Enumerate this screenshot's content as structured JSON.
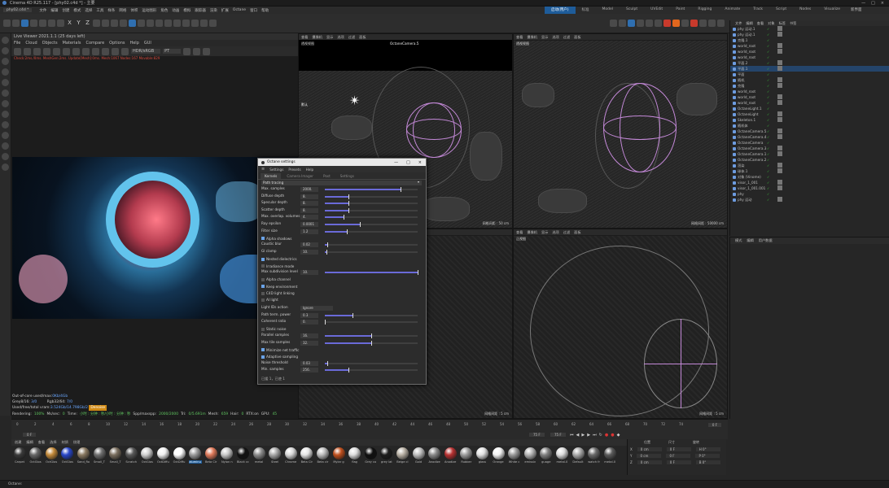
{
  "window": {
    "title": "Cinema 4D R25.117 - [phy02.c4d *] - 主要",
    "buttons": [
      "—",
      "□",
      "×"
    ]
  },
  "tabs": {
    "file": "phy02.c4d *"
  },
  "menubar": {
    "items": [
      "文件",
      "编辑",
      "创建",
      "模式",
      "选择",
      "工具",
      "样条",
      "网格",
      "体积",
      "运动图形",
      "角色",
      "动画",
      "模拟",
      "跟踪器",
      "渲染",
      "扩展",
      "Octane",
      "窗口",
      "帮助"
    ],
    "layouts": [
      "启动",
      "标准",
      "Model",
      "Sculpt",
      "UVEdit",
      "Paint",
      "Rigging",
      "Animate",
      "Track",
      "Script",
      "Nodes",
      "Visualize"
    ],
    "active_layout": "启动(用户)",
    "search": "新界面"
  },
  "toolbar": {
    "axes": [
      "X",
      "Y",
      "Z"
    ]
  },
  "live_viewer": {
    "title": "Live Viewer 2021.1.1 (25 days left)",
    "menu": [
      "File",
      "Cloud",
      "Objects",
      "Materials",
      "Compare",
      "Options",
      "Help",
      "GUI"
    ],
    "mode": "HDR/sRGB",
    "kernel": "PT",
    "info": "Check:2ms./0ms. MeshGen:2ms. Update[Mesh]:0ms. Mesh:1067 Nodes:167 Movable:829"
  },
  "render_stats": {
    "line1_label": "Out-of-core used/max:",
    "line1_val": "0Kb/4Gb",
    "line2_label": "Grey8/16:",
    "line2_val": "3/0",
    "line2b_label": "Rgb32/64:",
    "line2b_val": "7/0",
    "line3_label": "Used/free/total vram:",
    "line3_val": "3.524Gb/14.798Gb/2",
    "line3_badge": "Denoise"
  },
  "status": {
    "rendering_label": "Rendering:",
    "rendering": "100%",
    "ms_label": "Ms/sec:",
    "ms": "0",
    "time_label": "Time:",
    "time": "小时 : 分钟 : 秒/小时 : 分钟 : 秒",
    "spp_label": "Spp/maxspp:",
    "spp": "2000/2000",
    "tri_label": "Tri:",
    "tri": "0/5.691m",
    "mesh_label": "Mesh:",
    "mesh": "659",
    "hair_label": "Hair:",
    "hair": "0",
    "rtx_label": "RTX:on",
    "gpu_label": "GPU:",
    "gpu": "45"
  },
  "viewports": {
    "menu": [
      "查看",
      "摄像机",
      "显示",
      "选项",
      "过滤",
      "面板"
    ],
    "tl_title": "透视视图",
    "tl_camera": "OctaneCamera.5",
    "tl_label": "默认",
    "tl_scale": "网格间距 : 50 cm",
    "tr_title": "透视视图",
    "tr_scale": "网格间距 : 50000 cm",
    "br_title": "正视图",
    "br_scale": "网格间距 : 5 cm",
    "bl_scale": "网格间距 : 5 cm"
  },
  "object_manager": {
    "menu": [
      "文件",
      "编辑",
      "查看",
      "对象",
      "标签",
      "书签"
    ],
    "items": [
      "phy 运动.1",
      "phy 运动.1",
      "克隆.1",
      "world_root",
      "world_root",
      "world_root",
      "平面.2",
      "平面.1",
      "平面",
      "随机",
      "克隆",
      "world_root",
      "world_root",
      "world_root",
      "OctaneLight.1",
      "OctaneLight",
      "Skeleton.1",
      "随机体",
      "OctaneCamera.5",
      "OctaneCamera.4",
      "OctaneCamera",
      "OctaneCamera.3",
      "OctaneCamera.1",
      "OctaneCamera.2",
      "渲染",
      "球体.1",
      "对象 (Vinome)",
      "visor_1_001",
      "visor_1_001.001",
      "phy",
      "phy 运动"
    ]
  },
  "attributes": {
    "menu": [
      "模式",
      "编辑",
      "用户数据"
    ]
  },
  "octane_settings": {
    "title": "Octane settings",
    "menu": [
      "Settings",
      "Presets",
      "Help"
    ],
    "tabs": [
      "Kernels",
      "Camera Imager",
      "Post",
      "Settings"
    ],
    "kernel": "Path tracing",
    "params": [
      {
        "label": "Max. samples",
        "value": "2000.",
        "fill": 0.82
      },
      {
        "label": "Diffuse depth",
        "value": "8.",
        "fill": 0.25
      },
      {
        "label": "Specular depth",
        "value": "8.",
        "fill": 0.25
      },
      {
        "label": "Scatter depth",
        "value": "8.",
        "fill": 0.25
      },
      {
        "label": "Max. overlap. volumes",
        "value": "4.",
        "fill": 0.2
      },
      {
        "label": "Ray epsilon",
        "value": "0.0001",
        "fill": 0.38
      },
      {
        "label": "Filter size",
        "value": "1.2",
        "fill": 0.24
      }
    ],
    "checks1": [
      {
        "label": "Alpha shadows",
        "on": true
      }
    ],
    "params2": [
      {
        "label": "Caustic blur",
        "value": "0.02",
        "fill": 0.03
      },
      {
        "label": "GI clamp",
        "value": "10.",
        "fill": 0.02
      }
    ],
    "checks2": [
      {
        "label": "Nested dielectrics",
        "on": true
      },
      {
        "label": "Irradiance mode",
        "on": false
      }
    ],
    "params3": [
      {
        "label": "Max subdivision level",
        "value": "10.",
        "fill": 1.0
      }
    ],
    "checks3": [
      {
        "label": "Alpha channel",
        "on": false
      },
      {
        "label": "Keep environment",
        "on": true
      },
      {
        "label": "C4D light linking",
        "on": false
      },
      {
        "label": "AI light",
        "on": false
      }
    ],
    "light_action_label": "Light IDs action",
    "light_action": "Ignore",
    "params4": [
      {
        "label": "Path term. power",
        "value": "0.3",
        "fill": 0.3
      },
      {
        "label": "Coherent ratio",
        "value": "0.",
        "fill": 0.0
      }
    ],
    "checks4": [
      {
        "label": "Static noise",
        "on": false
      }
    ],
    "params5": [
      {
        "label": "Parallel samples",
        "value": "16.",
        "fill": 0.5
      },
      {
        "label": "Max tile samples",
        "value": "32.",
        "fill": 0.5
      }
    ],
    "checks5": [
      {
        "label": "Minimize net traffic",
        "on": true
      },
      {
        "label": "Adaptive sampling",
        "on": true
      }
    ],
    "params6": [
      {
        "label": "Noise threshold",
        "value": "0.03",
        "fill": 0.03
      },
      {
        "label": "Min. samples",
        "value": "256.",
        "fill": 0.25
      }
    ],
    "footer": "已缓 1，已使 1"
  },
  "timeline": {
    "ticks": [
      "0",
      "2",
      "4",
      "6",
      "8",
      "10",
      "12",
      "14",
      "16",
      "18",
      "20",
      "22",
      "24",
      "26",
      "28",
      "30",
      "32",
      "34",
      "36",
      "38",
      "40",
      "42",
      "44",
      "46",
      "48",
      "50",
      "52",
      "54",
      "56",
      "58",
      "60",
      "62",
      "64",
      "66",
      "68",
      "70",
      "72",
      "74"
    ],
    "frame_end": "0 F",
    "start": "0 F",
    "current": "75 F",
    "end": "75 F"
  },
  "material_bar": {
    "menu": [
      "创建",
      "编辑",
      "查看",
      "选择",
      "材质",
      "纹理"
    ]
  },
  "materials": [
    {
      "name": "Carpet",
      "color": "#3a3a3a"
    },
    {
      "name": "OctGlos",
      "color": "#666"
    },
    {
      "name": "OctGlos",
      "color": "#c48a3a"
    },
    {
      "name": "OctGlos",
      "color": "#2846c8"
    },
    {
      "name": "Sand_Ro",
      "color": "#8a7a62"
    },
    {
      "name": "Small_T",
      "color": "#6e6e6e"
    },
    {
      "name": "Small_T",
      "color": "#7a6e5e"
    },
    {
      "name": "Scratch",
      "color": "#585858"
    },
    {
      "name": "OctGlos",
      "color": "#cfcfcf"
    },
    {
      "name": "OctDiffu",
      "color": "#f0f0f0"
    },
    {
      "name": "OctDiffu",
      "color": "#ffffff"
    },
    {
      "name": "aluminu",
      "color": "#9a9a9a"
    },
    {
      "name": "Beta Cir",
      "color": "#e07a5a"
    },
    {
      "name": "Nylon n",
      "color": "#c8c8c8"
    },
    {
      "name": "Black cc",
      "color": "#121212"
    },
    {
      "name": "metal",
      "color": "#8c8c8c"
    },
    {
      "name": "Steel",
      "color": "#a8a8a8"
    },
    {
      "name": "Chrome",
      "color": "#d8d8d8"
    },
    {
      "name": "Beta Cir",
      "color": "#e6e6e6"
    },
    {
      "name": "Beta cir",
      "color": "#bcbcbc"
    },
    {
      "name": "Mylar g",
      "color": "#c0501e"
    },
    {
      "name": "flag",
      "color": "#dcdcdc"
    },
    {
      "name": "Grey co",
      "color": "#101010"
    },
    {
      "name": "grey lat",
      "color": "#1e1e1e"
    },
    {
      "name": "Beige cl",
      "color": "#b8b0a4"
    },
    {
      "name": "Gold",
      "color": "#bebebe"
    },
    {
      "name": "Anodize",
      "color": "#8a8a8a"
    },
    {
      "name": "Anodize",
      "color": "#b83232"
    },
    {
      "name": "Rubber",
      "color": "#9c9c9c"
    },
    {
      "name": "glass",
      "color": "#e0e0e0"
    },
    {
      "name": "Orange",
      "color": "#f2f2f2"
    },
    {
      "name": "White c",
      "color": "#9a9a9a"
    },
    {
      "name": "emissiv",
      "color": "#b4b4b4"
    },
    {
      "name": "guage",
      "color": "#808080"
    },
    {
      "name": "metal.0",
      "color": "#dcdcdc"
    },
    {
      "name": "Default",
      "color": "#aaaaaa"
    },
    {
      "name": "watch fr",
      "color": "#6a6a6a"
    },
    {
      "name": "metal.0",
      "color": "#5a5a5a"
    }
  ],
  "coords": {
    "headers": [
      "位置",
      "尺寸",
      "旋转"
    ],
    "rows": [
      {
        "axis": "X",
        "pos": "0 cm",
        "size": "0 F",
        "rot": "H 0°"
      },
      {
        "axis": "Y",
        "pos": "0 cm",
        "size": "0 F",
        "rot": "P 0°"
      },
      {
        "axis": "Z",
        "pos": "0 cm",
        "size": "0 F",
        "rot": "B 0°"
      }
    ]
  },
  "footer": {
    "text": "Octane:"
  },
  "colors": {
    "accent": "#1e5c9a",
    "wire": "#c489d8",
    "slider": "#6a6ad8",
    "check": "#3cc63c"
  }
}
